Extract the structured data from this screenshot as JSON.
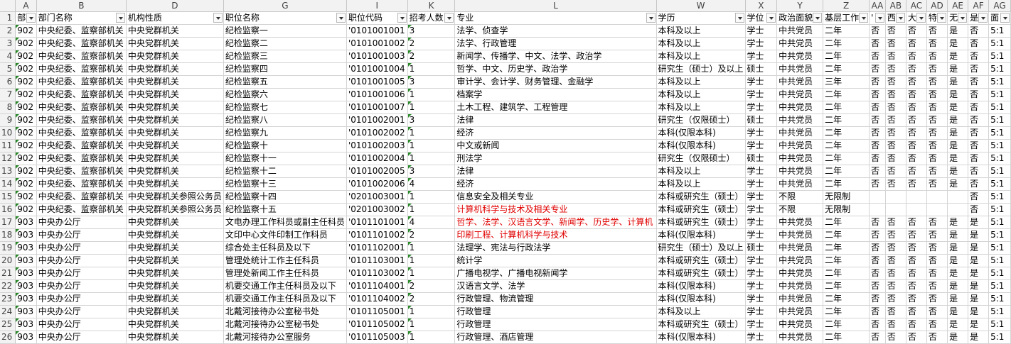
{
  "columns": [
    "A",
    "B",
    "D",
    "G",
    "I",
    "K",
    "L",
    "W",
    "X",
    "Y",
    "Z",
    "AA",
    "AB",
    "AC",
    "AD",
    "AE",
    "AF",
    "AG"
  ],
  "header_row": {
    "row_number": "1",
    "cells": [
      "部",
      "部门名称",
      "机构性质",
      "职位名称",
      "职位代码",
      "招考人数",
      "专业",
      "学历",
      "学位",
      "政治面貌",
      "基层工作",
      "'",
      "西",
      "大",
      "特",
      "无",
      "是",
      "面"
    ]
  },
  "rows": [
    {
      "n": "2",
      "A": "902",
      "B": "中央纪委、监察部机关",
      "D": "中央党群机关",
      "G": "纪检监察一",
      "I": "'0101001001",
      "K": "3",
      "L": "法学、侦查学",
      "W": "本科及以上",
      "X": "学士",
      "Y": "中共党员",
      "Z": "二年",
      "AA": "否",
      "AB": "否",
      "AC": "否",
      "AD": "否",
      "AE": "是",
      "AF": "否",
      "AG": "5:1"
    },
    {
      "n": "3",
      "A": "902",
      "B": "中央纪委、监察部机关",
      "D": "中央党群机关",
      "G": "纪检监察二",
      "I": "'0101001002",
      "K": "2",
      "L": "法学、行政管理",
      "W": "本科及以上",
      "X": "学士",
      "Y": "中共党员",
      "Z": "二年",
      "AA": "否",
      "AB": "否",
      "AC": "否",
      "AD": "否",
      "AE": "是",
      "AF": "否",
      "AG": "5:1"
    },
    {
      "n": "4",
      "A": "902",
      "B": "中央纪委、监察部机关",
      "D": "中央党群机关",
      "G": "纪检监察三",
      "I": "'0101001003",
      "K": "2",
      "L": "新闻学、传播学、中文、法学、政治学",
      "W": "本科及以上",
      "X": "学士",
      "Y": "中共党员",
      "Z": "二年",
      "AA": "否",
      "AB": "否",
      "AC": "否",
      "AD": "否",
      "AE": "是",
      "AF": "否",
      "AG": "5:1"
    },
    {
      "n": "5",
      "A": "902",
      "B": "中央纪委、监察部机关",
      "D": "中央党群机关",
      "G": "纪检监察四",
      "I": "'0101001004",
      "K": "1",
      "L": "哲学、中文、历史学、政治学",
      "W": "研究生（硕士）及以上",
      "X": "硕士",
      "Y": "中共党员",
      "Z": "二年",
      "AA": "否",
      "AB": "否",
      "AC": "否",
      "AD": "否",
      "AE": "是",
      "AF": "否",
      "AG": "5:1"
    },
    {
      "n": "6",
      "A": "902",
      "B": "中央纪委、监察部机关",
      "D": "中央党群机关",
      "G": "纪检监察五",
      "I": "'0101001005",
      "K": "3",
      "L": "审计学、会计学、财务管理、金融学",
      "W": "本科及以上",
      "X": "学士",
      "Y": "中共党员",
      "Z": "三年",
      "AA": "否",
      "AB": "否",
      "AC": "否",
      "AD": "否",
      "AE": "是",
      "AF": "否",
      "AG": "5:1"
    },
    {
      "n": "7",
      "A": "902",
      "B": "中央纪委、监察部机关",
      "D": "中央党群机关",
      "G": "纪检监察六",
      "I": "'0101001006",
      "K": "1",
      "L": "档案学",
      "W": "本科及以上",
      "X": "学士",
      "Y": "中共党员",
      "Z": "二年",
      "AA": "否",
      "AB": "否",
      "AC": "否",
      "AD": "否",
      "AE": "是",
      "AF": "否",
      "AG": "5:1"
    },
    {
      "n": "8",
      "A": "902",
      "B": "中央纪委、监察部机关",
      "D": "中央党群机关",
      "G": "纪检监察七",
      "I": "'0101001007",
      "K": "1",
      "L": "土木工程、建筑学、工程管理",
      "W": "本科及以上",
      "X": "学士",
      "Y": "中共党员",
      "Z": "二年",
      "AA": "否",
      "AB": "否",
      "AC": "否",
      "AD": "否",
      "AE": "是",
      "AF": "否",
      "AG": "5:1"
    },
    {
      "n": "9",
      "A": "902",
      "B": "中央纪委、监察部机关",
      "D": "中央党群机关",
      "G": "纪检监察八",
      "I": "'0101002001",
      "K": "3",
      "L": "法律",
      "W": "研究生（仅限硕士）",
      "X": "硕士",
      "Y": "中共党员",
      "Z": "二年",
      "AA": "否",
      "AB": "否",
      "AC": "否",
      "AD": "否",
      "AE": "是",
      "AF": "否",
      "AG": "5:1"
    },
    {
      "n": "10",
      "A": "902",
      "B": "中央纪委、监察部机关",
      "D": "中央党群机关",
      "G": "纪检监察九",
      "I": "'0101002002",
      "K": "1",
      "L": "经济",
      "W": "本科(仅限本科)",
      "X": "学士",
      "Y": "中共党员",
      "Z": "二年",
      "AA": "否",
      "AB": "否",
      "AC": "否",
      "AD": "否",
      "AE": "是",
      "AF": "否",
      "AG": "5:1"
    },
    {
      "n": "11",
      "A": "902",
      "B": "中央纪委、监察部机关",
      "D": "中央党群机关",
      "G": "纪检监察十",
      "I": "'0101002003",
      "K": "1",
      "L": "中文或新闻",
      "W": "本科(仅限本科)",
      "X": "学士",
      "Y": "中共党员",
      "Z": "二年",
      "AA": "否",
      "AB": "否",
      "AC": "否",
      "AD": "否",
      "AE": "是",
      "AF": "否",
      "AG": "5:1"
    },
    {
      "n": "12",
      "A": "902",
      "B": "中央纪委、监察部机关",
      "D": "中央党群机关",
      "G": "纪检监察十一",
      "I": "'0101002004",
      "K": "1",
      "L": "刑法学",
      "W": "研究生（仅限硕士）",
      "X": "硕士",
      "Y": "中共党员",
      "Z": "二年",
      "AA": "否",
      "AB": "否",
      "AC": "否",
      "AD": "否",
      "AE": "是",
      "AF": "否",
      "AG": "5:1"
    },
    {
      "n": "13",
      "A": "902",
      "B": "中央纪委、监察部机关",
      "D": "中央党群机关",
      "G": "纪检监察十二",
      "I": "'0101002005",
      "K": "3",
      "L": "法律",
      "W": "本科及以上",
      "X": "学士",
      "Y": "中共党员",
      "Z": "二年",
      "AA": "否",
      "AB": "否",
      "AC": "否",
      "AD": "否",
      "AE": "是",
      "AF": "否",
      "AG": "5:1"
    },
    {
      "n": "14",
      "A": "902",
      "B": "中央纪委、监察部机关",
      "D": "中央党群机关",
      "G": "纪检监察十三",
      "I": "'0101002006",
      "K": "4",
      "L": "经济",
      "W": "本科及以上",
      "X": "学士",
      "Y": "中共党员",
      "Z": "二年",
      "AA": "否",
      "AB": "否",
      "AC": "否",
      "AD": "否",
      "AE": "是",
      "AF": "否",
      "AG": "5:1"
    },
    {
      "n": "15",
      "A": "902",
      "B": "中央纪委、监察部机关",
      "D": "中央党群机关参照公务员",
      "G": "纪检监察十四",
      "I": "'0201003001",
      "K": "1",
      "L": "信息安全及相关专业",
      "W": "本科或研究生（硕士）",
      "X": "学士",
      "Y": "不限",
      "Z": "无限制",
      "AA": "",
      "AB": "",
      "AC": "",
      "AD": "",
      "AE": "",
      "AF": "否",
      "AG": "5:1"
    },
    {
      "n": "16",
      "A": "902",
      "B": "中央纪委、监察部机关",
      "D": "中央党群机关参照公务员",
      "G": "纪检监察十五",
      "I": "'0201003002",
      "K": "1",
      "L": "计算机科学与技术及相关专业",
      "red": true,
      "W": "本科或研究生（硕士）",
      "X": "学士",
      "Y": "不限",
      "Z": "无限制",
      "AA": "",
      "AB": "",
      "AC": "",
      "AD": "",
      "AE": "",
      "AF": "否",
      "AG": "5:1"
    },
    {
      "n": "17",
      "A": "903",
      "B": "中央办公厅",
      "D": "中央党群机关",
      "G": "文电办理工作科员或副主任科员",
      "I": "'0101101001",
      "K": "4",
      "L": "哲学、法学、汉语言文学、新闻学、历史学、计算机",
      "red": true,
      "W": "本科或研究生（硕士）",
      "X": "学士",
      "Y": "中共党员",
      "Z": "二年",
      "AA": "否",
      "AB": "否",
      "AC": "否",
      "AD": "否",
      "AE": "是",
      "AF": "是",
      "AG": "5:1"
    },
    {
      "n": "18",
      "A": "903",
      "B": "中央办公厅",
      "D": "中央党群机关",
      "G": "文印中心文件印制工作科员",
      "I": "'0101101002",
      "K": "2",
      "L": "印刷工程、计算机科学与技术",
      "red": true,
      "W": "本科(仅限本科)",
      "X": "学士",
      "Y": "中共党员",
      "Z": "二年",
      "AA": "否",
      "AB": "否",
      "AC": "否",
      "AD": "否",
      "AE": "是",
      "AF": "是",
      "AG": "5:1"
    },
    {
      "n": "19",
      "A": "903",
      "B": "中央办公厅",
      "D": "中央党群机关",
      "G": "综合处主任科员及以下",
      "I": "'0101102001",
      "K": "1",
      "L": "法理学、宪法与行政法学",
      "W": "研究生（硕士）及以上",
      "X": "硕士",
      "Y": "中共党员",
      "Z": "二年",
      "AA": "否",
      "AB": "否",
      "AC": "否",
      "AD": "否",
      "AE": "是",
      "AF": "是",
      "AG": "5:1"
    },
    {
      "n": "20",
      "A": "903",
      "B": "中央办公厅",
      "D": "中央党群机关",
      "G": "管理处统计工作主任科员",
      "I": "'0101103001",
      "K": "1",
      "L": "统计学",
      "W": "本科或研究生（硕士）",
      "X": "学士",
      "Y": "中共党员",
      "Z": "二年",
      "AA": "否",
      "AB": "否",
      "AC": "否",
      "AD": "否",
      "AE": "是",
      "AF": "是",
      "AG": "5:1"
    },
    {
      "n": "21",
      "A": "903",
      "B": "中央办公厅",
      "D": "中央党群机关",
      "G": "管理处新闻工作主任科员",
      "I": "'0101103002",
      "K": "1",
      "L": "广播电视学、广播电视新闻学",
      "W": "本科或研究生（硕士）",
      "X": "学士",
      "Y": "中共党员",
      "Z": "二年",
      "AA": "否",
      "AB": "否",
      "AC": "否",
      "AD": "否",
      "AE": "是",
      "AF": "是",
      "AG": "5:1"
    },
    {
      "n": "22",
      "A": "903",
      "B": "中央办公厅",
      "D": "中央党群机关",
      "G": "机要交通工作主任科员及以下",
      "I": "'0101104001",
      "K": "2",
      "L": "汉语言文学、法学",
      "W": "本科(仅限本科)",
      "X": "学士",
      "Y": "中共党员",
      "Z": "二年",
      "AA": "否",
      "AB": "否",
      "AC": "否",
      "AD": "否",
      "AE": "是",
      "AF": "是",
      "AG": "5:1"
    },
    {
      "n": "23",
      "A": "903",
      "B": "中央办公厅",
      "D": "中央党群机关",
      "G": "机要交通工作主任科员及以下",
      "I": "'0101104002",
      "K": "2",
      "L": "行政管理、物流管理",
      "W": "本科(仅限本科)",
      "X": "学士",
      "Y": "中共党员",
      "Z": "二年",
      "AA": "否",
      "AB": "否",
      "AC": "否",
      "AD": "否",
      "AE": "是",
      "AF": "是",
      "AG": "5:1"
    },
    {
      "n": "24",
      "A": "903",
      "B": "中央办公厅",
      "D": "中央党群机关",
      "G": "北戴河接待办公室秘书处",
      "I": "'0101105001",
      "K": "1",
      "L": "行政管理",
      "W": "本科及以上",
      "X": "学士",
      "Y": "中共党员",
      "Z": "二年",
      "AA": "否",
      "AB": "否",
      "AC": "否",
      "AD": "否",
      "AE": "是",
      "AF": "是",
      "AG": "5:1"
    },
    {
      "n": "25",
      "A": "903",
      "B": "中央办公厅",
      "D": "中央党群机关",
      "G": "北戴河接待办公室秘书处",
      "I": "'0101105002",
      "K": "1",
      "L": "行政管理",
      "W": "本科或研究生（硕士）",
      "X": "学士",
      "Y": "中共党员",
      "Z": "二年",
      "AA": "否",
      "AB": "否",
      "AC": "否",
      "AD": "否",
      "AE": "是",
      "AF": "是",
      "AG": "5:1"
    },
    {
      "n": "26",
      "A": "903",
      "B": "中央办公厅",
      "D": "中央党群机关",
      "G": "北戴河接待办公室服务",
      "I": "'0101105003",
      "K": "1",
      "L": "行政管理、酒店管理",
      "W": "本科(仅限本科)",
      "X": "学士",
      "Y": "中共党员",
      "Z": "二年",
      "AA": "否",
      "AB": "否",
      "AC": "否",
      "AD": "否",
      "AE": "是",
      "AF": "是",
      "AG": "5:1"
    }
  ]
}
